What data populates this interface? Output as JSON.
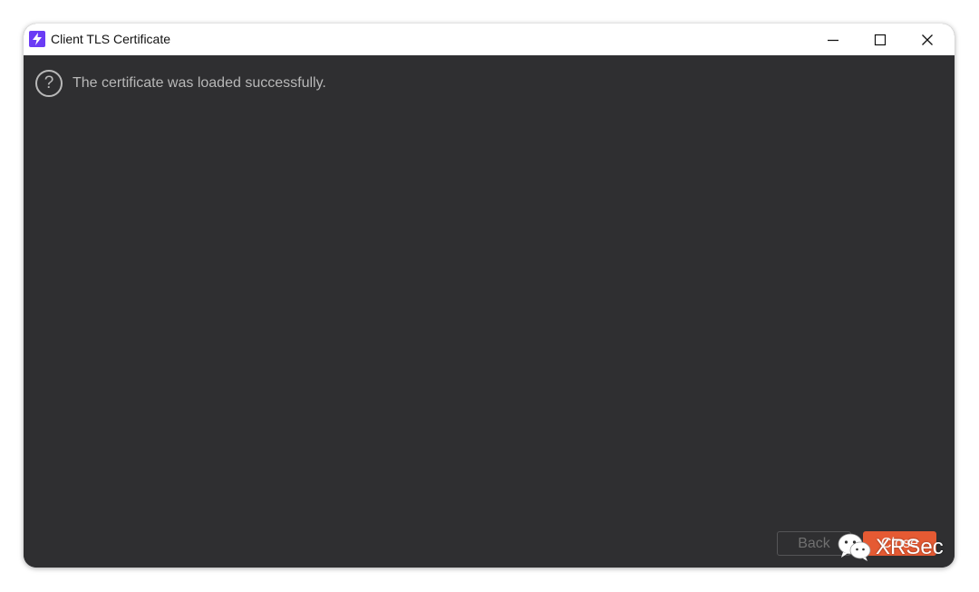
{
  "window": {
    "title": "Client TLS Certificate",
    "app_icon": "lightning-icon",
    "controls": {
      "minimize": "minimize-icon",
      "maximize": "maximize-icon",
      "close": "close-icon"
    }
  },
  "dialog": {
    "icon": "question-icon",
    "icon_glyph": "?",
    "message": "The certificate was loaded successfully."
  },
  "buttons": {
    "back_label": "Back",
    "close_label": "Close"
  },
  "watermark": {
    "text": "XRSec",
    "logo": "wechat-icon"
  },
  "colors": {
    "content_bg": "#2f2f31",
    "accent": "#e55a33",
    "app_icon_bg": "#6b3cf5"
  }
}
